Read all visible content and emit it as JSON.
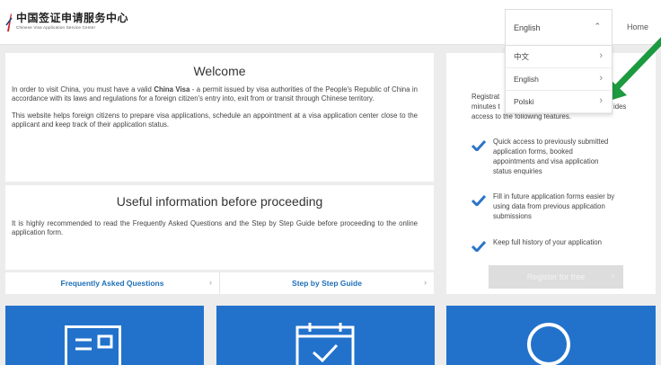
{
  "header": {
    "logo_cn": "中国签证申请服务中心",
    "logo_en": "Chinese Visa Application Service Center",
    "language_current": "English",
    "home_label": "Home"
  },
  "language_menu": {
    "options": [
      {
        "label": "中文"
      },
      {
        "label": "English"
      },
      {
        "label": "Polski"
      }
    ]
  },
  "welcome": {
    "title": "Welcome",
    "p1_start": "In order to visit China, you must have a valid ",
    "p1_bold": "China Visa",
    "p1_end": " - a permit issued by visa authorities of the People's Republic of China in accordance with its laws and regulations for a foreign citizen's entry into, exit from or transit through Chinese territory.",
    "p2": "This website helps foreign citizens to prepare visa applications, schedule an appointment at a visa application center close to the applicant and keep track of their application status."
  },
  "useful_info": {
    "title": "Useful information before proceeding",
    "paragraph": "It is highly recommended to read the Frequently Asked Questions and the Step by Step Guide before proceeding to the online application form."
  },
  "links": {
    "faq": "Frequently Asked Questions",
    "guide": "Step by Step Guide"
  },
  "register_card": {
    "line1": "Registrat",
    "line1_end": "ides",
    "line2": "minutes t",
    "line3": "access to the following features.",
    "features": [
      {
        "lines": [
          "Quick access to previously submitted",
          "application forms, booked",
          "appointments and visa application",
          "status enquiries"
        ]
      },
      {
        "lines": [
          "Fill in future application forms easier by",
          "using data from previous application",
          "submissions"
        ]
      },
      {
        "lines": [
          "Keep full history of your application"
        ]
      }
    ],
    "button_label": "Register for free"
  },
  "colors": {
    "accent": "#1d6fb8",
    "tile_blue": "#2272cc",
    "check_blue": "#2b74c6",
    "arrow_green": "#1b9a3f"
  },
  "icons": [
    "chevron-up-icon",
    "chevron-right-icon",
    "check-icon",
    "form-icon",
    "calendar-check-icon",
    "search-icon",
    "arrow-annotation-icon"
  ]
}
